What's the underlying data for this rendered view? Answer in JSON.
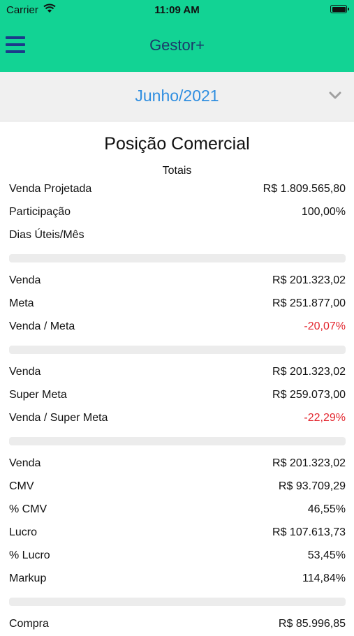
{
  "status_bar": {
    "carrier": "Carrier",
    "time": "11:09 AM"
  },
  "nav": {
    "title": "Gestor+"
  },
  "period": {
    "label": "Junho/2021"
  },
  "report": {
    "title": "Posição Comercial",
    "subtitle": "Totais"
  },
  "totais": [
    {
      "label": "Venda Projetada",
      "value": "R$ 1.809.565,80"
    },
    {
      "label": "Participação",
      "value": "100,00%"
    },
    {
      "label": "Dias Úteis/Mês",
      "value": ""
    }
  ],
  "meta": [
    {
      "label": "Venda",
      "value": "R$ 201.323,02"
    },
    {
      "label": "Meta",
      "value": "R$ 251.877,00"
    },
    {
      "label": "Venda / Meta",
      "value": "-20,07%"
    }
  ],
  "super_meta": [
    {
      "label": "Venda",
      "value": "R$ 201.323,02"
    },
    {
      "label": "Super Meta",
      "value": "R$ 259.073,00"
    },
    {
      "label": "Venda / Super Meta",
      "value": "-22,29%"
    }
  ],
  "lucro": [
    {
      "label": "Venda",
      "value": "R$ 201.323,02"
    },
    {
      "label": "CMV",
      "value": "R$ 93.709,29"
    },
    {
      "label": "% CMV",
      "value": "46,55%"
    },
    {
      "label": "Lucro",
      "value": "R$ 107.613,73"
    },
    {
      "label": "% Lucro",
      "value": "53,45%"
    },
    {
      "label": "Markup",
      "value": "114,84%"
    }
  ],
  "compras": [
    {
      "label": "Compra",
      "value": "R$ 85.996,85"
    }
  ],
  "colors": {
    "header": "#12d394",
    "accent": "#2f8ee0",
    "negative": "#e3262e"
  }
}
